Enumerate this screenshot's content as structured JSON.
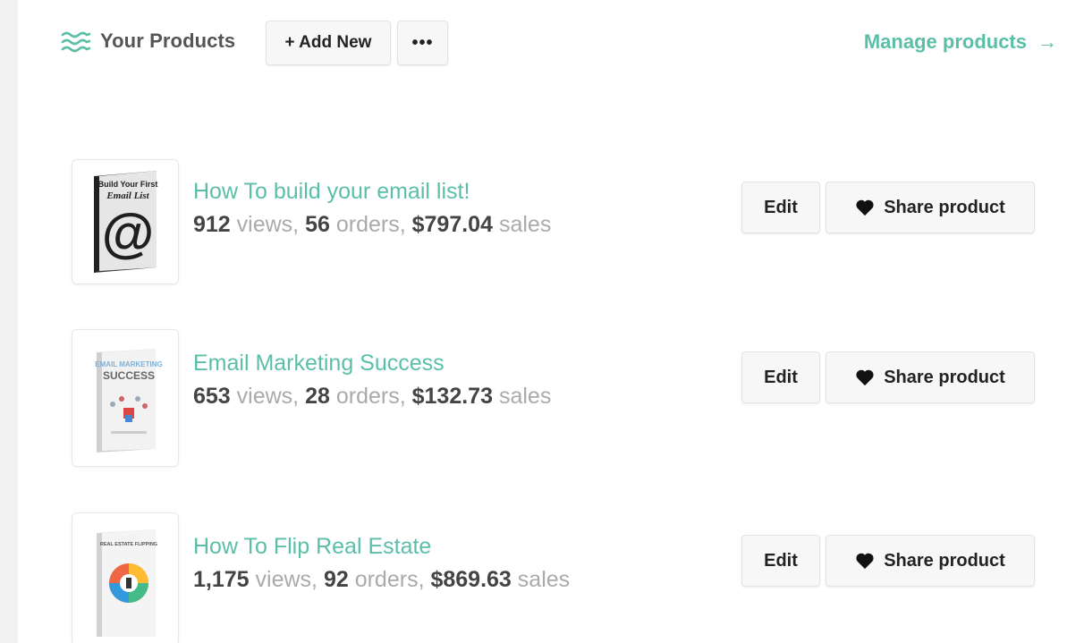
{
  "header": {
    "title": "Your Products",
    "add_new_label": "+ Add New",
    "more_label": "•••",
    "manage_label": "Manage products",
    "manage_arrow": "→"
  },
  "colors": {
    "accent": "#5bbfa8",
    "button_bg": "#f7f7f7",
    "strong_text": "#444444",
    "muted_text": "#aaaaaa"
  },
  "products": [
    {
      "title": "How To build your email list!",
      "views": "912",
      "views_label": "views,",
      "orders": "56",
      "orders_label": "orders,",
      "sales": "$797.04",
      "sales_label": "sales",
      "cover_title_line1": "Build Your First",
      "cover_title_line2": "Email List",
      "edit_label": "Edit",
      "share_label": "Share product"
    },
    {
      "title": "Email Marketing Success",
      "views": "653",
      "views_label": "views,",
      "orders": "28",
      "orders_label": "orders,",
      "sales": "$132.73",
      "sales_label": "sales",
      "cover_title_line1": "EMAIL MARKETING",
      "cover_title_line2": "SUCCESS",
      "edit_label": "Edit",
      "share_label": "Share product"
    },
    {
      "title": "How To Flip Real Estate",
      "views": "1,175",
      "views_label": "views,",
      "orders": "92",
      "orders_label": "orders,",
      "sales": "$869.63",
      "sales_label": "sales",
      "cover_title_line1": "REAL ESTATE FLIPPING",
      "cover_title_line2": "",
      "edit_label": "Edit",
      "share_label": "Share product"
    }
  ]
}
